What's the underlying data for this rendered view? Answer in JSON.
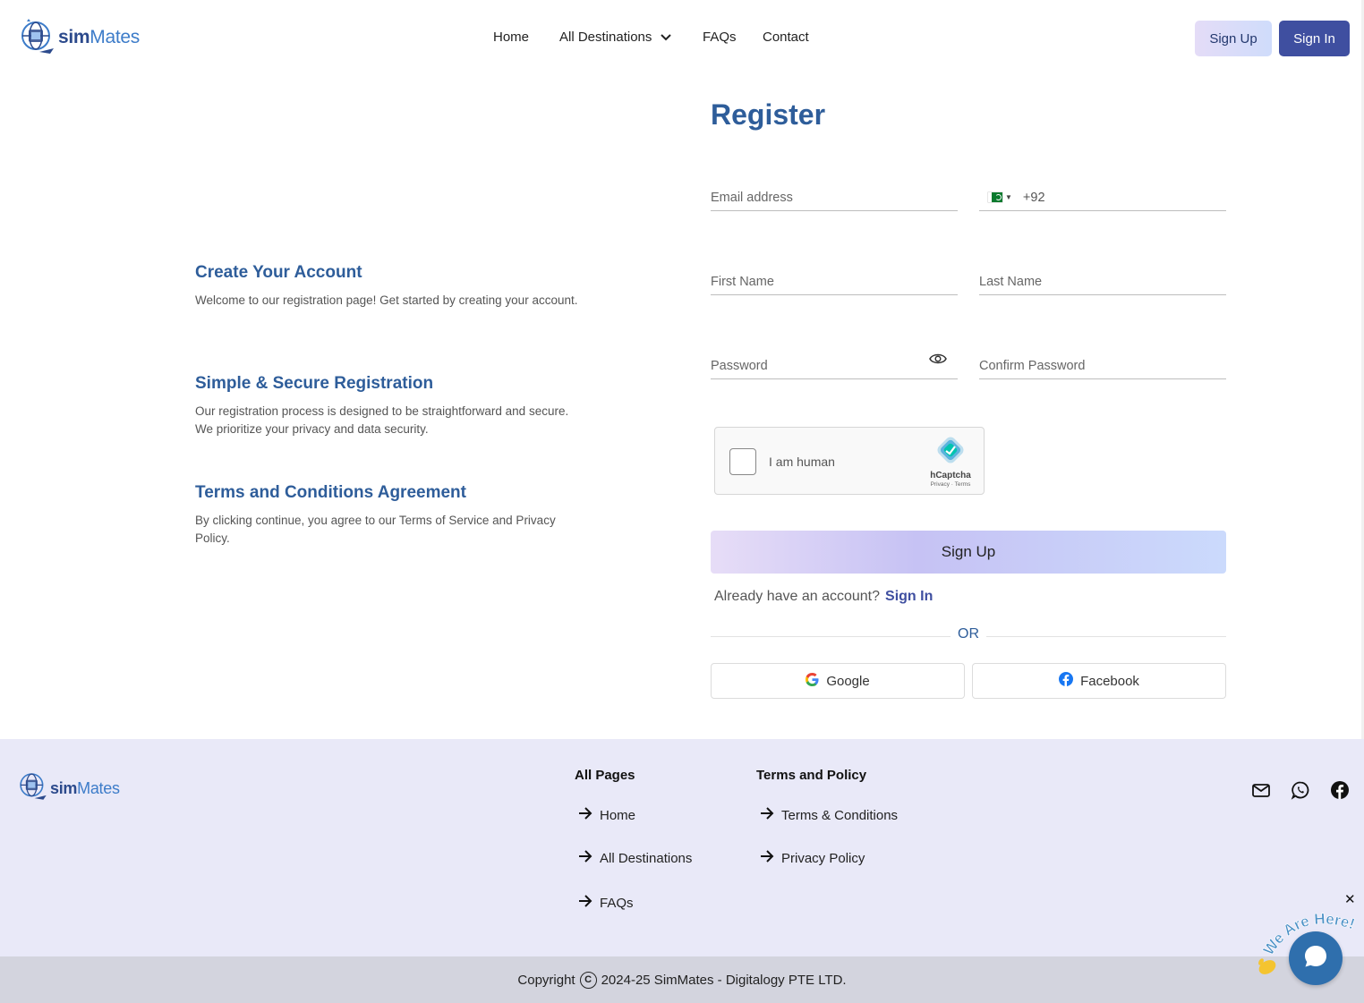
{
  "header": {
    "logo": {
      "sim": "sim",
      "mates": "Mates"
    },
    "nav": {
      "home": "Home",
      "destinations": "All Destinations",
      "faqs": "FAQs",
      "contact": "Contact"
    },
    "sign_up": "Sign Up",
    "sign_in": "Sign In"
  },
  "info": [
    {
      "title": "Create Your Account",
      "text": "Welcome to our registration page! Get started by creating your account."
    },
    {
      "title": "Simple & Secure Registration",
      "text": "Our registration process is designed to be straightforward and secure. We prioritize your privacy and data security."
    },
    {
      "title": "Terms and Conditions Agreement",
      "text": "By clicking continue, you agree to our Terms of Service and Privacy Policy."
    }
  ],
  "form": {
    "title": "Register",
    "email_placeholder": "Email address",
    "phone_code": "+92",
    "first_name_placeholder": "First Name",
    "last_name_placeholder": "Last Name",
    "password_placeholder": "Password",
    "confirm_password_placeholder": "Confirm Password",
    "captcha": {
      "label": "I am human",
      "brand": "hCaptcha",
      "links": "Privacy · Terms"
    },
    "submit": "Sign Up",
    "already": "Already have an account?",
    "sign_in_link": "Sign In",
    "or": "OR",
    "google": "Google",
    "facebook": "Facebook"
  },
  "footer": {
    "logo": {
      "sim": "sim",
      "mates": "Mates"
    },
    "all_pages": {
      "title": "All Pages",
      "links": [
        "Home",
        "All Destinations",
        "FAQs"
      ]
    },
    "terms": {
      "title": "Terms and Policy",
      "links": [
        "Terms & Conditions",
        "Privacy Policy"
      ]
    },
    "copyright_prefix": "Copyright",
    "copyright_text": "2024-25 SimMates - Digitalogy PTE LTD.",
    "chat_tag": "We Are Here!"
  },
  "colors": {
    "brand_dark": "#2c4a8c",
    "brand_light": "#3d7cc9",
    "heading": "#2e5d9a",
    "primary_button": "#3f4fa0",
    "footer_bg": "#e9e9f8",
    "copyright_bg": "#d3d4de"
  },
  "icons": [
    "logo-globe-icon",
    "chevron-down-icon",
    "eye-icon",
    "flag-pakistan-icon",
    "hcaptcha-icon",
    "google-icon",
    "facebook-icon",
    "arrow-right-icon",
    "mail-icon",
    "whatsapp-icon",
    "facebook-round-icon",
    "copyright-icon",
    "chat-icon",
    "close-icon"
  ]
}
